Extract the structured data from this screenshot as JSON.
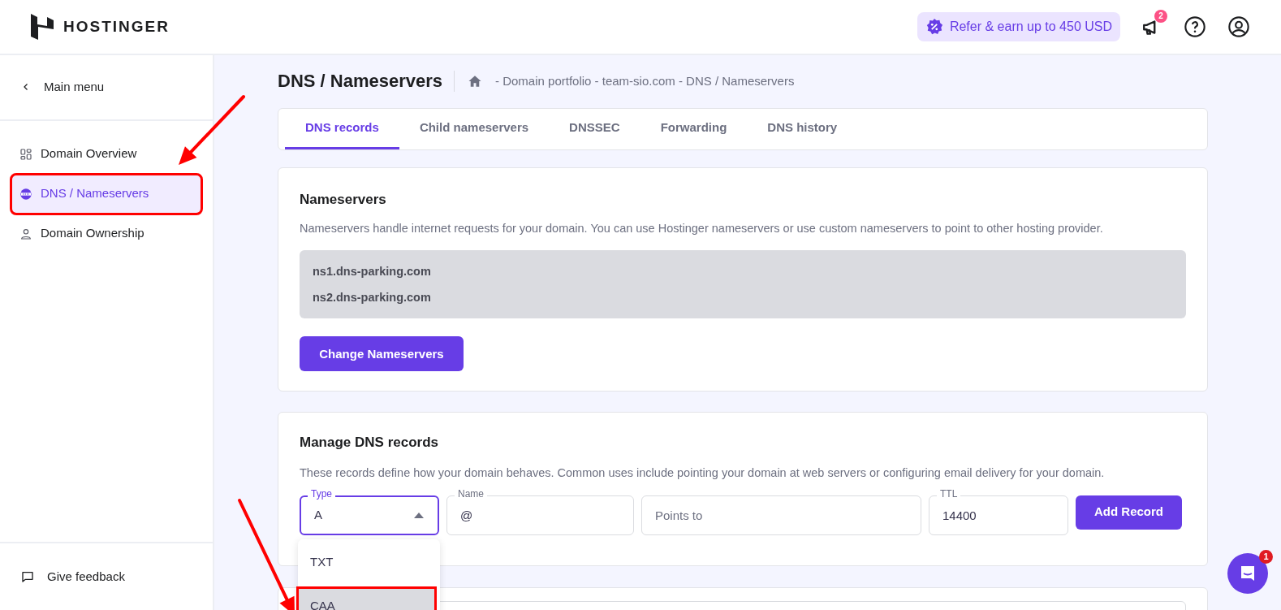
{
  "header": {
    "logo": "HOSTINGER",
    "referral": "Refer & earn up to 450 USD",
    "notifications_badge": "2"
  },
  "sidebar": {
    "back": "Main menu",
    "items": [
      {
        "label": "Domain Overview",
        "kind": "grid",
        "selected": false,
        "annotated": false
      },
      {
        "label": "DNS / Nameservers",
        "kind": "dns",
        "selected": true,
        "annotated": true
      },
      {
        "label": "Domain Ownership",
        "kind": "person",
        "selected": false,
        "annotated": false
      }
    ],
    "feedback": "Give feedback"
  },
  "page": {
    "title": "DNS / Nameservers",
    "breadcrumb": "- Domain portfolio - team-sio.com - DNS / Nameservers"
  },
  "tabs": [
    {
      "label": "DNS records",
      "selected": true
    },
    {
      "label": "Child nameservers",
      "selected": false
    },
    {
      "label": "DNSSEC",
      "selected": false
    },
    {
      "label": "Forwarding",
      "selected": false
    },
    {
      "label": "DNS history",
      "selected": false
    }
  ],
  "nameservers": {
    "title": "Nameservers",
    "description": "Nameservers handle internet requests for your domain. You can use Hostinger nameservers or use custom nameservers to point to other hosting provider.",
    "servers": [
      "ns1.dns-parking.com",
      "ns2.dns-parking.com"
    ],
    "button": "Change Nameservers"
  },
  "dns_records": {
    "title": "Manage DNS records",
    "description": "These records define how your domain behaves. Common uses include pointing your domain at web servers or configuring email delivery for your domain.",
    "type_field": {
      "label": "Type",
      "value": "A",
      "expanded": true,
      "options": [
        {
          "label": "TXT",
          "selected": false,
          "annotated": false
        },
        {
          "label": "CAA",
          "selected": true,
          "annotated": true
        }
      ]
    },
    "name_field": {
      "label": "Name",
      "value": "@"
    },
    "points_to_field": {
      "placeholder": "Points to"
    },
    "ttl_field": {
      "label": "TTL",
      "value": "14400"
    },
    "button": "Add Record"
  },
  "chat": {
    "badge": "1"
  }
}
